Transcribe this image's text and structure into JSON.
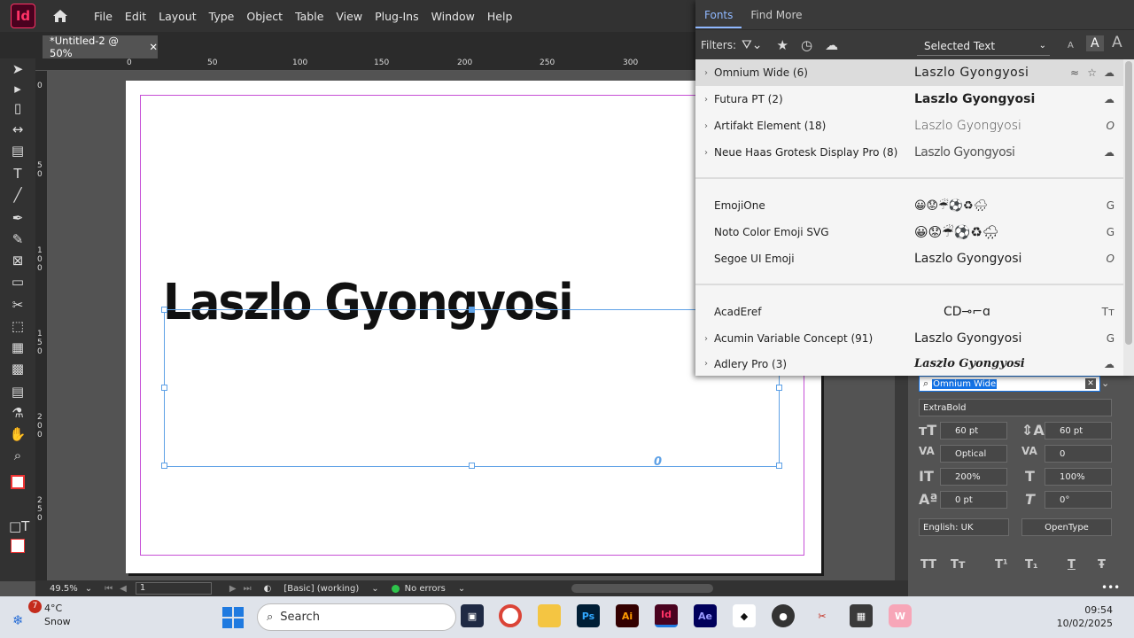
{
  "app": {
    "logo_text": "Id"
  },
  "menu": [
    "File",
    "Edit",
    "Layout",
    "Type",
    "Object",
    "Table",
    "View",
    "Plug-Ins",
    "Window",
    "Help"
  ],
  "document": {
    "tab_title": "*Untitled-2 @ 50%"
  },
  "ruler": {
    "top_ticks": [
      "0",
      "50",
      "100",
      "150",
      "200",
      "250",
      "300"
    ],
    "left_ticks": [
      "0",
      "50",
      "100",
      "150",
      "200",
      "250"
    ]
  },
  "canvas": {
    "sample_text": "Laszlo Gyongyosi",
    "overset_marker": "0"
  },
  "status": {
    "zoom": "49.5%",
    "page": "1",
    "style": "[Basic] (working)",
    "preflight": "No errors"
  },
  "fonts_panel": {
    "tabs": [
      "Fonts",
      "Find More"
    ],
    "filters_label": "Filters:",
    "preview_source": "Selected Text",
    "groups": [
      [
        {
          "name": "Omnium Wide (6)",
          "sample": "Laszlo Gyongyosi",
          "expandable": true,
          "selected": true
        },
        {
          "name": "Futura PT (2)",
          "sample": "Laszlo Gyongyosi",
          "expandable": true
        },
        {
          "name": "Artifakt Element (18)",
          "sample": "Laszlo Gyongyosi",
          "expandable": true
        },
        {
          "name": "Neue Haas Grotesk Display Pro (8)",
          "sample": "Laszlo Gyongyosi",
          "expandable": true
        }
      ],
      [
        {
          "name": "EmojiOne",
          "sample": "😀😟☔⚽♻🌧",
          "expandable": false
        },
        {
          "name": "Noto Color Emoji SVG",
          "sample": "😀😟☔⚽♻🌧",
          "expandable": false
        },
        {
          "name": "Segoe UI Emoji",
          "sample": "Laszlo Gyongyosi",
          "expandable": false
        }
      ],
      [
        {
          "name": "AcadEref",
          "sample": "CD⊸⌐ɑ",
          "expandable": false
        },
        {
          "name": "Acumin Variable Concept (91)",
          "sample": "Laszlo Gyongyosi",
          "expandable": true
        },
        {
          "name": "Adlery Pro (3)",
          "sample": "Laszlo Gyongyosi",
          "expandable": true
        }
      ]
    ]
  },
  "character": {
    "font_value": "Omnium Wide",
    "style_value": "ExtraBold",
    "size": "60 pt",
    "leading": "60 pt",
    "kerning": "Optical",
    "tracking": "0",
    "vscale": "200%",
    "hscale": "100%",
    "baseline": "0 pt",
    "skew": "0°",
    "language": "English: UK",
    "opentype": "OpenType",
    "type_buttons": [
      "TT",
      "Tт",
      "T¹",
      "T₁",
      "T",
      "Ŧ"
    ]
  },
  "taskbar": {
    "weather_badge": "7",
    "temp": "4°C",
    "condition": "Snow",
    "search_label": "Search",
    "time": "09:54",
    "date": "10/02/2025"
  },
  "colors": {
    "id_brand": "#ff3366",
    "selection": "#1473e6",
    "frame": "#5ea1e6",
    "margin": "#c64fd6"
  }
}
